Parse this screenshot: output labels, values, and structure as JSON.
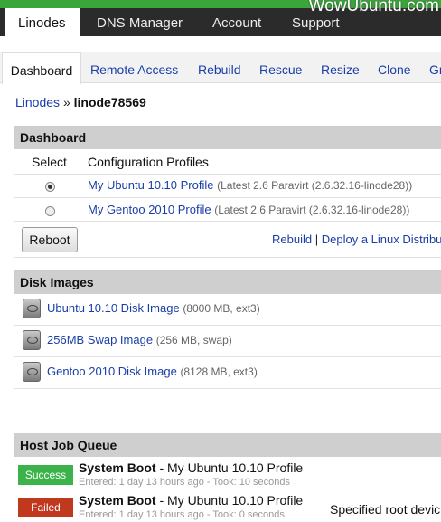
{
  "watermark": "WowUbuntu.com",
  "topnav": [
    "Linodes",
    "DNS Manager",
    "Account",
    "Support"
  ],
  "subnav": [
    "Dashboard",
    "Remote Access",
    "Rebuild",
    "Rescue",
    "Resize",
    "Clone",
    "Gr"
  ],
  "breadcrumb": {
    "parent": "Linodes",
    "sep": "»",
    "current": "linode78569"
  },
  "dashboard": {
    "title": "Dashboard",
    "col_select": "Select",
    "col_profiles": "Configuration Profiles",
    "profiles": [
      {
        "name": "My Ubuntu 10.10 Profile",
        "meta": "(Latest 2.6 Paravirt (2.6.32.16-linode28))",
        "selected": true
      },
      {
        "name": "My Gentoo 2010 Profile",
        "meta": "(Latest 2.6 Paravirt (2.6.32.16-linode28))",
        "selected": false
      }
    ],
    "reboot_label": "Reboot",
    "action_rebuild": "Rebuild",
    "action_sep": "|",
    "action_deploy": "Deploy a Linux Distribu"
  },
  "disks": {
    "title": "Disk Images",
    "items": [
      {
        "name": "Ubuntu 10.10 Disk Image",
        "meta": "(8000 MB, ext3)"
      },
      {
        "name": "256MB Swap Image",
        "meta": "(256 MB, swap)"
      },
      {
        "name": "Gentoo 2010 Disk Image",
        "meta": "(8128 MB, ext3)"
      }
    ]
  },
  "jobs": {
    "title": "Host Job Queue",
    "items": [
      {
        "status": "Success",
        "status_color": "#3bb34a",
        "title": "System Boot",
        "profile": "- My Ubuntu 10.10 Profile",
        "meta": "Entered: 1 day 13 hours ago - Took: 10 seconds",
        "note": ""
      },
      {
        "status": "Failed",
        "status_color": "#c0391f",
        "title": "System Boot",
        "profile": "- My Ubuntu 10.10 Profile",
        "meta": "Entered: 1 day 13 hours ago - Took: 0 seconds",
        "note": "Specified root devic"
      }
    ]
  }
}
